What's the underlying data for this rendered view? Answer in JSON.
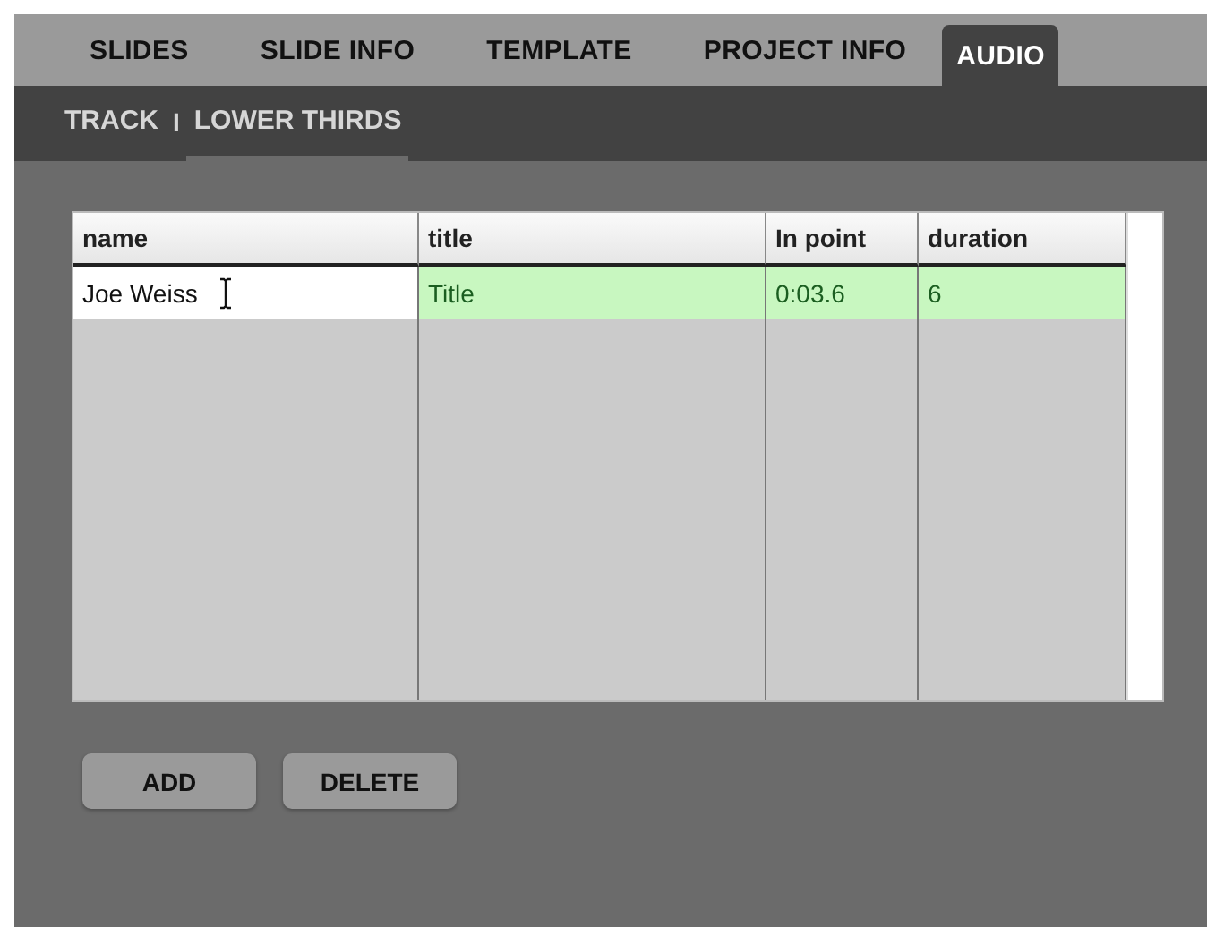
{
  "tabs": [
    {
      "label": "SLIDES",
      "selected": false
    },
    {
      "label": "SLIDE INFO",
      "selected": false
    },
    {
      "label": "TEMPLATE",
      "selected": false
    },
    {
      "label": "PROJECT INFO",
      "selected": false
    },
    {
      "label": "AUDIO",
      "selected": true
    }
  ],
  "subtabs": [
    {
      "label": "TRACK",
      "selected": false
    },
    {
      "label": "LOWER THIRDS",
      "selected": true
    }
  ],
  "subtab_separator": "I",
  "table": {
    "columns": [
      "name",
      "title",
      "In point",
      "duration"
    ],
    "rows": [
      {
        "selected": true,
        "cells": [
          {
            "text": "Joe Weiss",
            "editing": true
          },
          {
            "text": "Title",
            "editing": false
          },
          {
            "text": "0:03.6",
            "editing": false
          },
          {
            "text": "6",
            "editing": false
          }
        ]
      }
    ]
  },
  "buttons": [
    "ADD",
    "DELETE"
  ]
}
